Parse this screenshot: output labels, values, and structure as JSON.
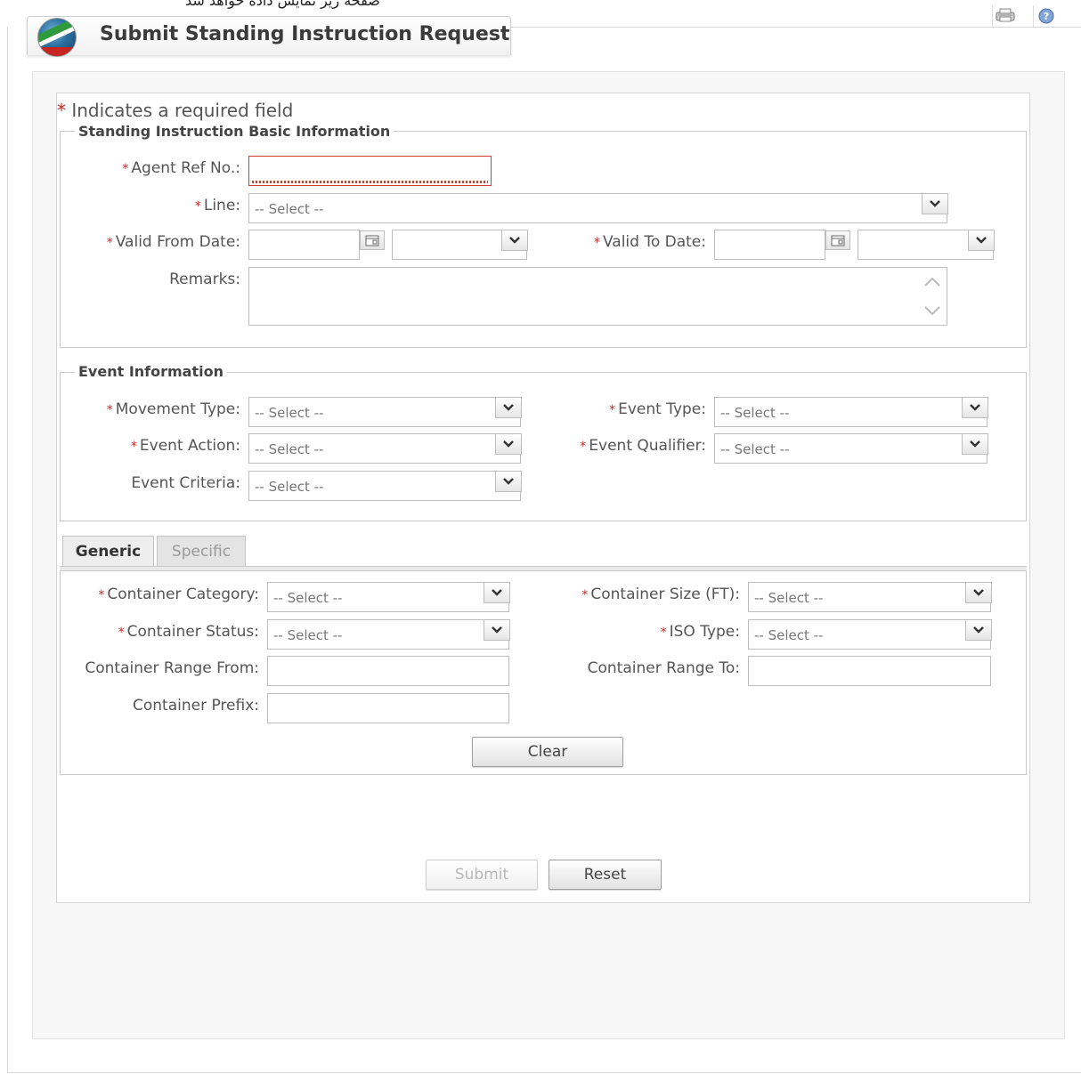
{
  "top_caption": "صفحه زیر نمایش داده خواهد شد",
  "window": {
    "title": "Submit Standing Instruction Request"
  },
  "required_note": "Indicates a required field",
  "required_star": "*",
  "basic_info": {
    "legend": "Standing Instruction Basic Information",
    "agent_ref_label": "Agent Ref No.:",
    "agent_ref_value": "",
    "line_label": "Line:",
    "line_value": "-- Select --",
    "valid_from_label": "Valid From Date:",
    "valid_to_label": "Valid To Date:",
    "remarks_label": "Remarks:"
  },
  "event_info": {
    "legend": "Event Information",
    "movement_type_label": "Movement Type:",
    "movement_type_value": "-- Select --",
    "event_type_label": "Event Type:",
    "event_type_value": "-- Select --",
    "event_action_label": "Event Action:",
    "event_action_value": "-- Select --",
    "event_qualifier_label": "Event Qualifier:",
    "event_qualifier_value": "-- Select --",
    "event_criteria_label": "Event Criteria:",
    "event_criteria_value": "-- Select --"
  },
  "tabs": [
    {
      "label": "Generic",
      "active": true
    },
    {
      "label": "Specific",
      "active": false
    }
  ],
  "generic": {
    "container_category_label": "Container Category:",
    "container_category_value": "-- Select --",
    "container_size_label": "Container Size (FT):",
    "container_size_value": "-- Select --",
    "container_status_label": "Container Status:",
    "container_status_value": "-- Select --",
    "iso_type_label": "ISO Type:",
    "iso_type_value": "-- Select --",
    "range_from_label": "Container Range From:",
    "range_to_label": "Container Range To:",
    "prefix_label": "Container Prefix:",
    "clear_label": "Clear"
  },
  "actions": {
    "submit_label": "Submit",
    "reset_label": "Reset"
  },
  "icons": {
    "print": "print-icon",
    "help": "help-icon",
    "logo": "globe-logo",
    "calendar": "calendar-icon",
    "dropdown": "chevron-down-icon"
  },
  "colors": {
    "required_star": "#c62828",
    "error_border": "#d33b2a"
  }
}
